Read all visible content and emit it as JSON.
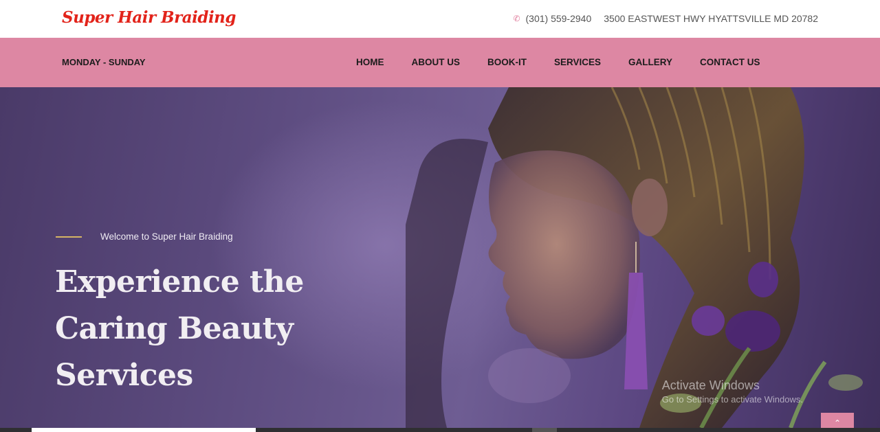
{
  "header": {
    "logo": "Super Hair Braiding",
    "phone": "(301) 559-2940",
    "address": "3500 EASTWEST HWY HYATTSVILLE MD 20782"
  },
  "nav": {
    "hours": "MONDAY - SUNDAY",
    "items": [
      {
        "label": "HOME"
      },
      {
        "label": "ABOUT US"
      },
      {
        "label": "BOOK-IT"
      },
      {
        "label": "SERVICES"
      },
      {
        "label": "GALLERY"
      },
      {
        "label": "CONTACT US"
      }
    ]
  },
  "hero": {
    "tagline": "Welcome to Super Hair Braiding",
    "headline_line1": "Experience the",
    "headline_line2": "Caring Beauty",
    "headline_line3": "Services"
  },
  "system": {
    "watermark_title": "Activate Windows",
    "watermark_sub": "Go to Settings to activate Windows."
  },
  "icons": {
    "phone": "phone-icon",
    "scroll_top": "chevron-up-icon"
  },
  "colors": {
    "logo": "#e2231a",
    "nav_bg": "#dd87a3",
    "hero_purple": "#5d4c80",
    "accent_gold": "#d6b564"
  }
}
